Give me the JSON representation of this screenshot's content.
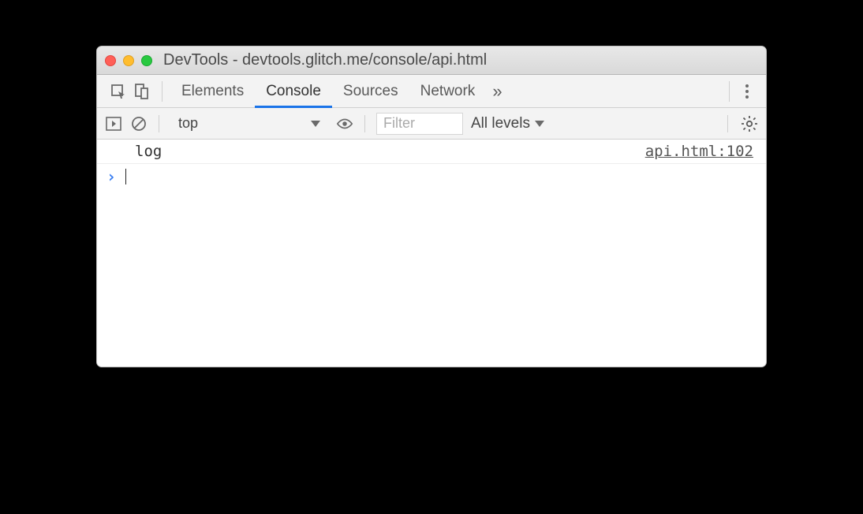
{
  "window": {
    "title": "DevTools - devtools.glitch.me/console/api.html"
  },
  "tabs": {
    "elements": "Elements",
    "console": "Console",
    "sources": "Sources",
    "network": "Network",
    "more": "»"
  },
  "toolbar": {
    "context": "top",
    "filter_placeholder": "Filter",
    "levels": "All levels"
  },
  "console": {
    "log_text": "log",
    "source_ref": "api.html:102",
    "prompt": "›"
  }
}
